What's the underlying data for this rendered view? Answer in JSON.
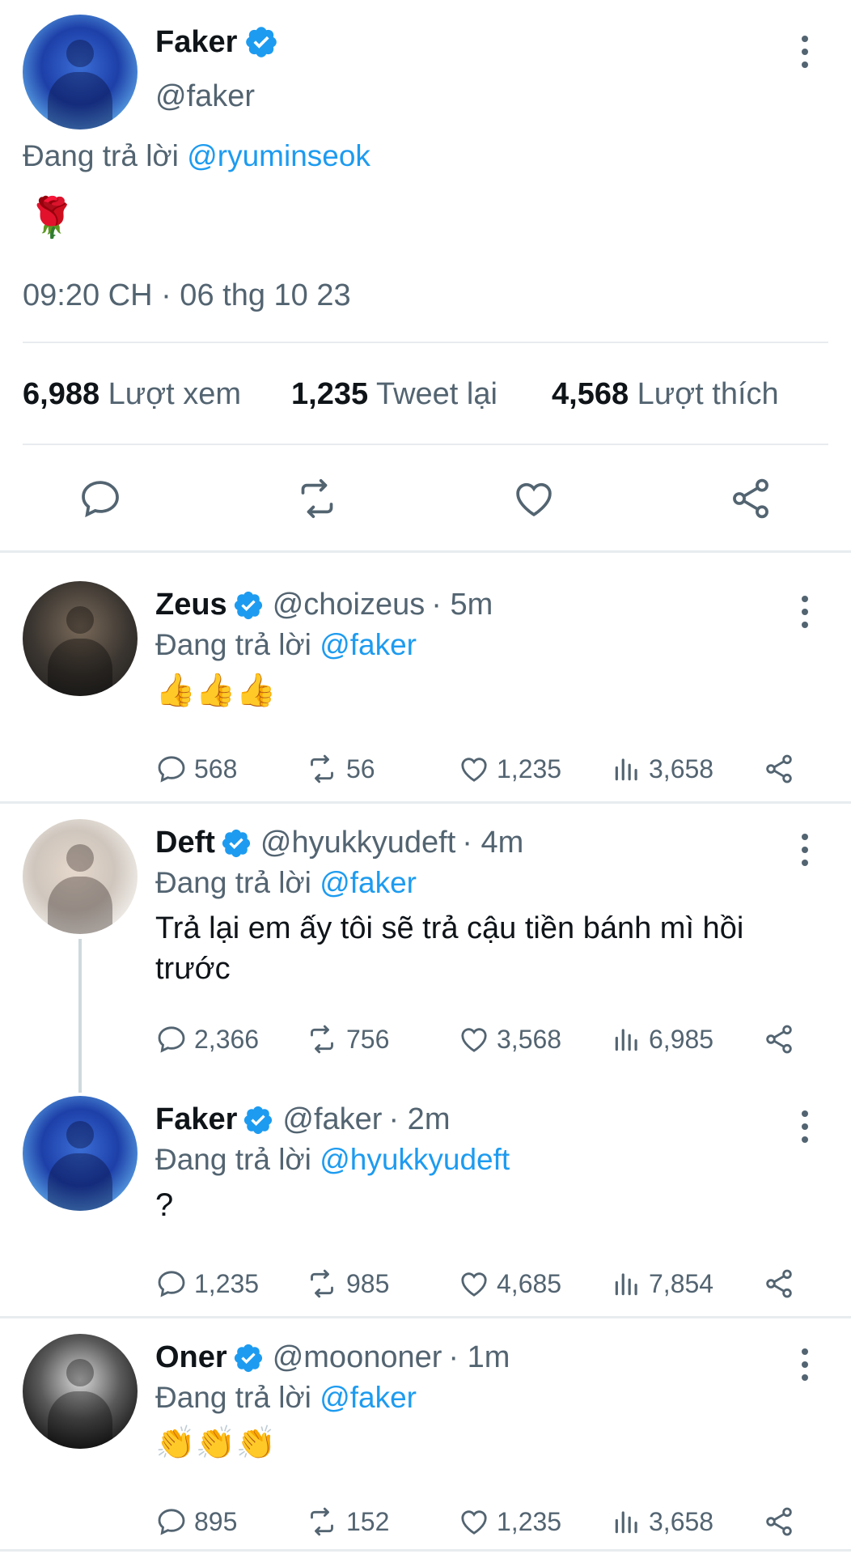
{
  "main_tweet": {
    "name": "Faker",
    "handle": "@faker",
    "replying_prefix": "Đang trả lời",
    "replying_to": "@ryuminseok",
    "content_emoji": "🌹",
    "timestamp": "09:20 CH · 06 thg 10 23",
    "stats": {
      "views_count": "6,988",
      "views_label": "Lượt xem",
      "retweets_count": "1,235",
      "retweets_label": "Tweet lại",
      "likes_count": "4,568",
      "likes_label": "Lượt thích"
    }
  },
  "replies": [
    {
      "name": "Zeus",
      "handle": "@choizeus",
      "time": "· 5m",
      "replying_prefix": "Đang trả lời",
      "replying_to": "@faker",
      "content": "👍👍👍",
      "replies": "568",
      "retweets": "56",
      "likes": "1,235",
      "views": "3,658"
    },
    {
      "name": "Deft",
      "handle": "@hyukkyudeft",
      "time": "· 4m",
      "replying_prefix": "Đang trả lời",
      "replying_to": "@faker",
      "content": "Trả lại em ấy tôi sẽ trả cậu tiền bánh mì hồi trước",
      "replies": "2,366",
      "retweets": "756",
      "likes": "3,568",
      "views": "6,985"
    },
    {
      "name": "Faker",
      "handle": "@faker",
      "time": "· 2m",
      "replying_prefix": "Đang trả lời",
      "replying_to": "@hyukkyudeft",
      "content": "?",
      "replies": "1,235",
      "retweets": "985",
      "likes": "4,685",
      "views": "7,854"
    },
    {
      "name": "Oner",
      "handle": "@moononer",
      "time": "· 1m",
      "replying_prefix": "Đang trả lời",
      "replying_to": "@faker",
      "content": "👏👏👏",
      "replies": "895",
      "retweets": "152",
      "likes": "1,235",
      "views": "3,658"
    }
  ],
  "colors": {
    "accent": "#1d9bf0",
    "muted": "#536471",
    "divider": "#e8ecef"
  },
  "icons": [
    "verified-badge-icon",
    "more-options-icon",
    "reply-icon",
    "retweet-icon",
    "like-icon",
    "share-icon",
    "views-icon"
  ]
}
